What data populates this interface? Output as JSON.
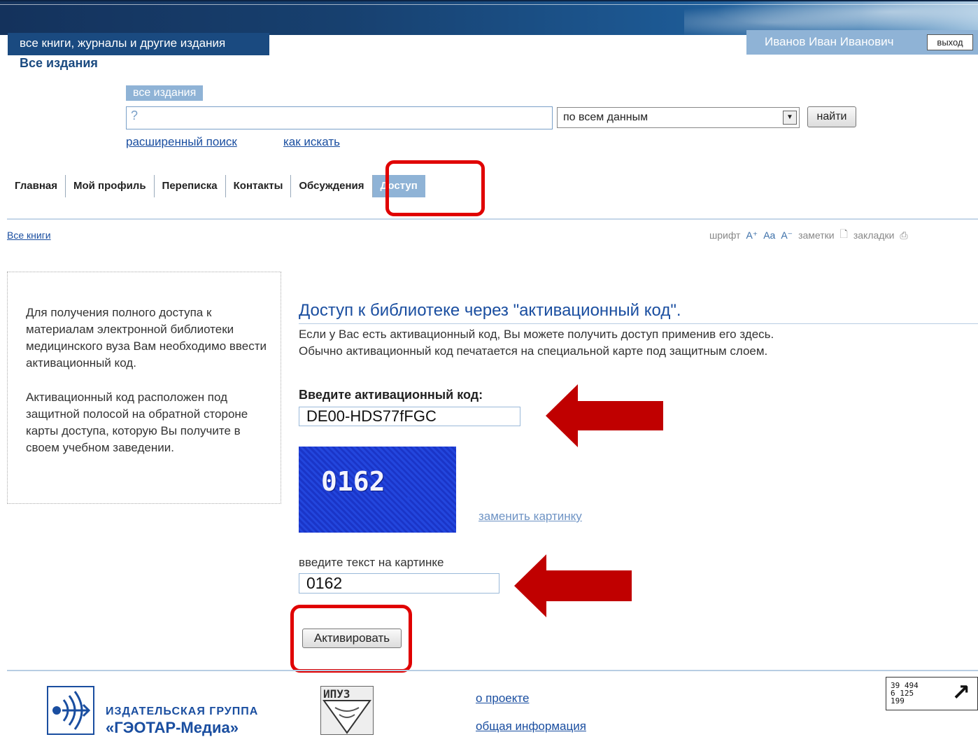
{
  "header": {
    "section_tab": "все книги, журналы и другие издания",
    "user_name": "Иванов Иван Иванович",
    "logout_label": "выход",
    "page_heading": "Все издания"
  },
  "search": {
    "label": "все издания",
    "input_value": "?",
    "select_value": "по всем данным",
    "find_label": "найти",
    "advanced_link": "расширенный поиск",
    "howto_link": "как искать"
  },
  "nav": {
    "tabs": [
      {
        "label": "Главная",
        "active": false
      },
      {
        "label": "Мой профиль",
        "active": false
      },
      {
        "label": "Переписка",
        "active": false
      },
      {
        "label": "Контакты",
        "active": false
      },
      {
        "label": "Обсуждения",
        "active": false
      },
      {
        "label": "Доступ",
        "active": true
      }
    ]
  },
  "breadcrumb": {
    "all_books": "Все книги"
  },
  "tools": {
    "font_label": "шрифт",
    "notes_label": "заметки",
    "bookmarks_label": "закладки"
  },
  "info": {
    "para1": "Для получения полного доступа к материалам электронной библиотеки медицинского вуза Вам необходимо ввести активационный код.",
    "para2": "Активационный код расположен под защитной полосой на обратной стороне карты доступа, которую Вы получите в своем учебном заведении."
  },
  "form": {
    "title": "Доступ к библиотеке через \"активационный код\".",
    "desc_line1": "Если у Вас есть активационный код, Вы можете получить доступ применив его здесь.",
    "desc_line2": "Обычно активационный код печатается на специальной карте под защитным слоем.",
    "code_label": "Введите активационный код:",
    "code_value": "DE00-HDS77fFGC",
    "captcha_text": "0162",
    "replace_link": "заменить картинку",
    "text_label": "введите текст на картинке",
    "captcha_value": "0162",
    "activate_label": "Активировать"
  },
  "footer": {
    "publisher_line1": "ИЗДАТЕЛЬСКАЯ ГРУППА",
    "publisher_line2": "«ГЭОТАР-Медиа»",
    "ipuz_label": "ИПУЗ",
    "about_link": "о проекте",
    "general_link": "общая информация",
    "counter_text": "39 494\n6 125\n199"
  },
  "colors": {
    "highlight_red": "#e00000",
    "arrow_red": "#c00000",
    "brand_blue": "#1a4a80",
    "tab_active": "#8fb3d6"
  }
}
